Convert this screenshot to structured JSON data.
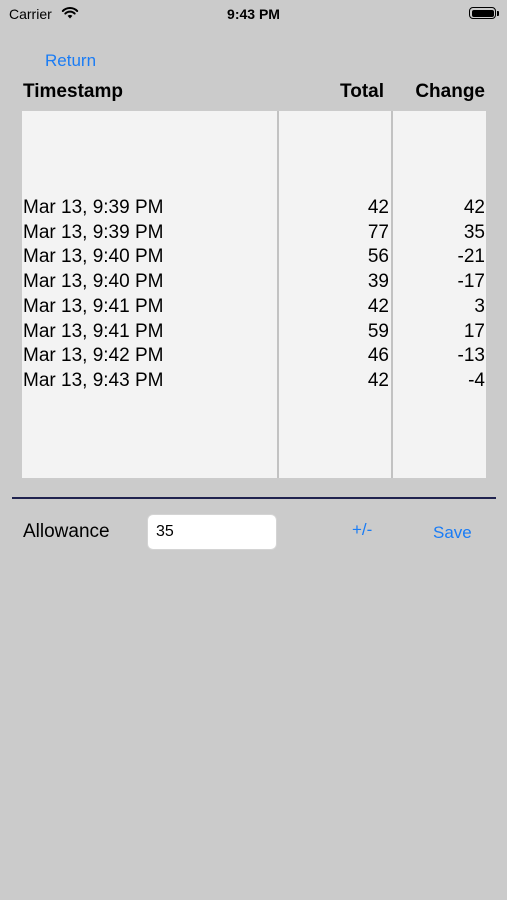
{
  "status_bar": {
    "carrier": "Carrier",
    "time": "9:43 PM",
    "icons": [
      "wifi-icon",
      "battery-icon"
    ]
  },
  "nav": {
    "return_label": "Return"
  },
  "table": {
    "headers": {
      "timestamp": "Timestamp",
      "total": "Total",
      "change": "Change"
    },
    "rows": [
      {
        "timestamp": "Mar 13, 9:39 PM",
        "total": "42",
        "change": "42"
      },
      {
        "timestamp": "Mar 13, 9:39 PM",
        "total": "77",
        "change": "35"
      },
      {
        "timestamp": "Mar 13, 9:40 PM",
        "total": "56",
        "change": "-21"
      },
      {
        "timestamp": "Mar 13, 9:40 PM",
        "total": "39",
        "change": "-17"
      },
      {
        "timestamp": "Mar 13, 9:41 PM",
        "total": "42",
        "change": "3"
      },
      {
        "timestamp": "Mar 13, 9:41 PM",
        "total": "59",
        "change": "17"
      },
      {
        "timestamp": "Mar 13, 9:42 PM",
        "total": "46",
        "change": "-13"
      },
      {
        "timestamp": "Mar 13, 9:43 PM",
        "total": "42",
        "change": "-4"
      }
    ]
  },
  "allowance": {
    "label": "Allowance",
    "value": "35",
    "plus_minus_label": "+/-",
    "save_label": "Save"
  },
  "colors": {
    "accent": "#1a7cf5",
    "background": "#cbcbcb",
    "table_background": "#f3f3f3",
    "divider": "#20234f"
  }
}
